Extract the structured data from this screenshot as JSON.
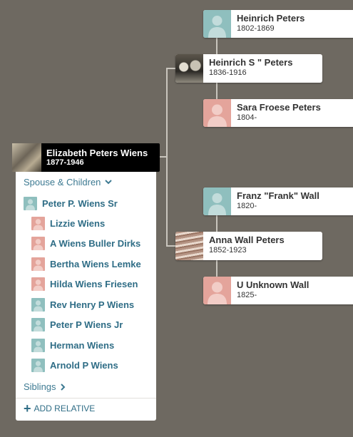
{
  "focus_person": {
    "name": "Elizabeth Peters Wiens",
    "dates": "1877-1946"
  },
  "parents": [
    {
      "name": "Heinrich S \" Peters",
      "dates": "1836-1916"
    },
    {
      "name": "Anna Wall Peters",
      "dates": "1852-1923"
    }
  ],
  "grandparents": [
    {
      "name": "Heinrich Peters",
      "dates": "1802-1869"
    },
    {
      "name": "Sara Froese Peters",
      "dates": "1804-"
    },
    {
      "name": "Franz \"Frank\" Wall",
      "dates": "1820-"
    },
    {
      "name": "U Unknown Wall",
      "dates": "1825-"
    }
  ],
  "panel": {
    "spouse_children_label": "Spouse & Children",
    "spouse": "Peter P. Wiens Sr",
    "children": [
      "Lizzie Wiens",
      "A Wiens Buller Dirks",
      "Bertha Wiens Lemke",
      "Hilda Wiens Friesen",
      "Rev Henry P Wiens",
      "Peter P Wiens Jr",
      "Herman Wiens",
      "Arnold P Wiens"
    ],
    "siblings_label": "Siblings",
    "add_relative_label": "ADD RELATIVE"
  },
  "icons": {
    "male_color": "#8fbfbe",
    "female_color": "#e4a49b",
    "link_color": "#2f6d86"
  }
}
